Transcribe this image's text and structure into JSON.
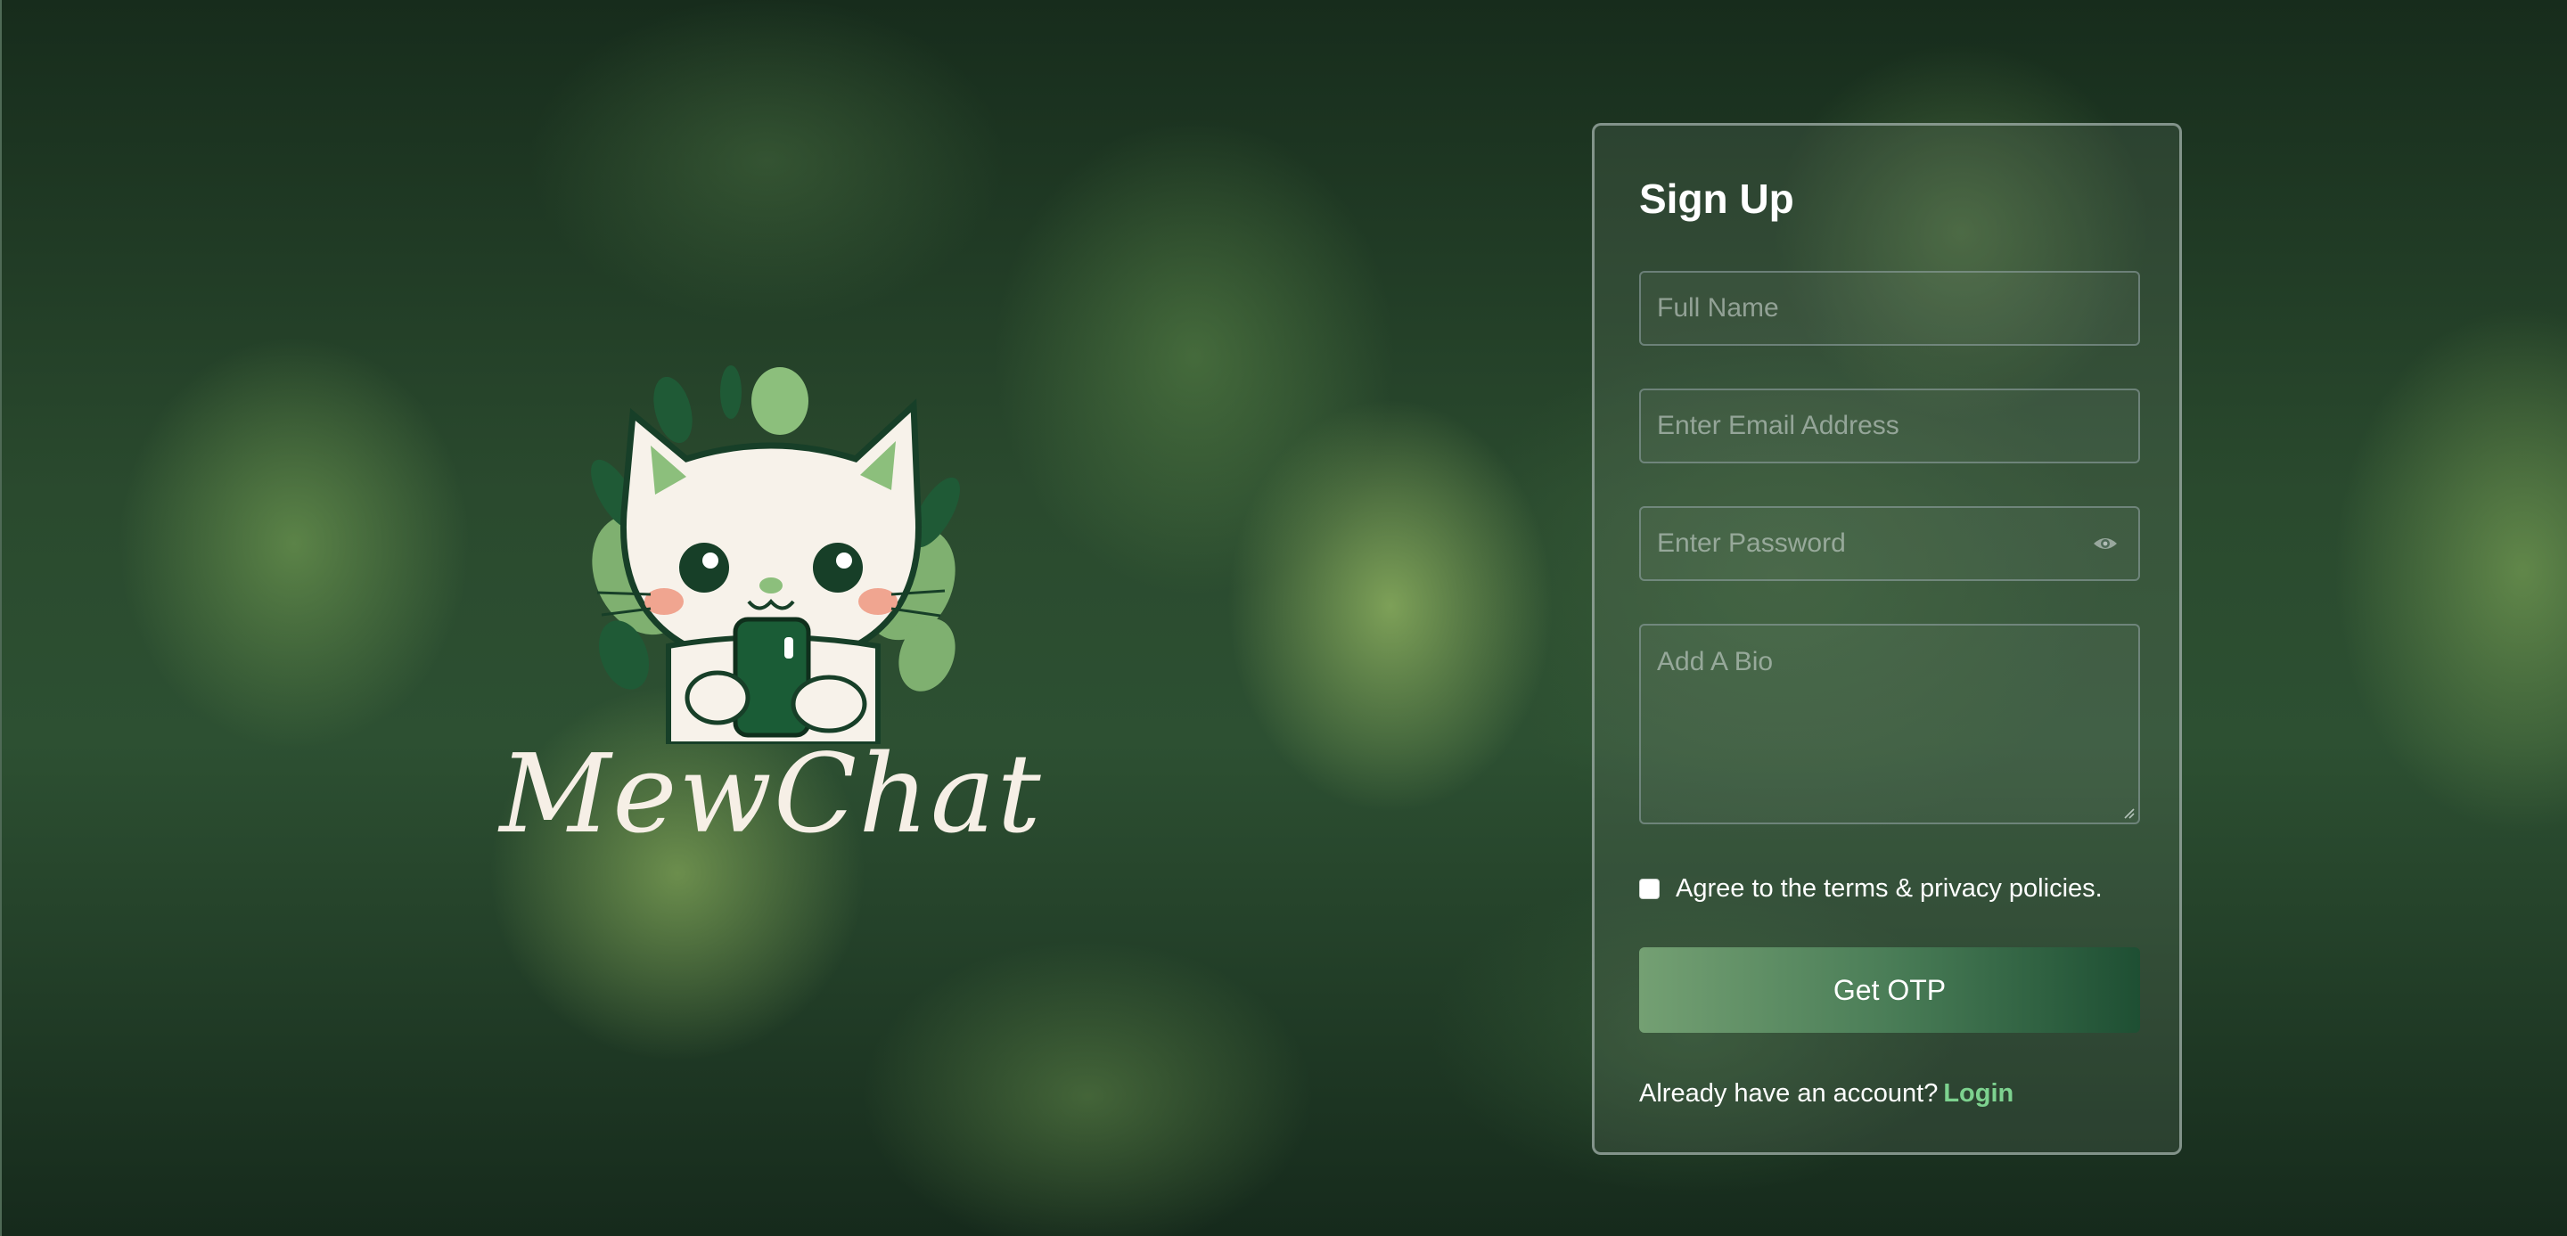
{
  "brand": {
    "name": "MewChat"
  },
  "signup": {
    "title": "Sign Up",
    "full_name_placeholder": "Full Name",
    "email_placeholder": "Enter Email Address",
    "password_placeholder": "Enter Password",
    "bio_placeholder": "Add A Bio",
    "agree_text": "Agree to the terms & privacy policies.",
    "agree_checked": false,
    "otp_label": "Get OTP",
    "already_text": "Already have an account?",
    "login_label": "Login"
  },
  "colors": {
    "accent_button_start": "#74a073",
    "accent_button_end": "#1e4f33",
    "login_link": "#7dd28f",
    "brand_text": "#f6efe6"
  },
  "icons": {
    "password_toggle": "eye-icon",
    "logo": "cat-with-phone-logo"
  }
}
